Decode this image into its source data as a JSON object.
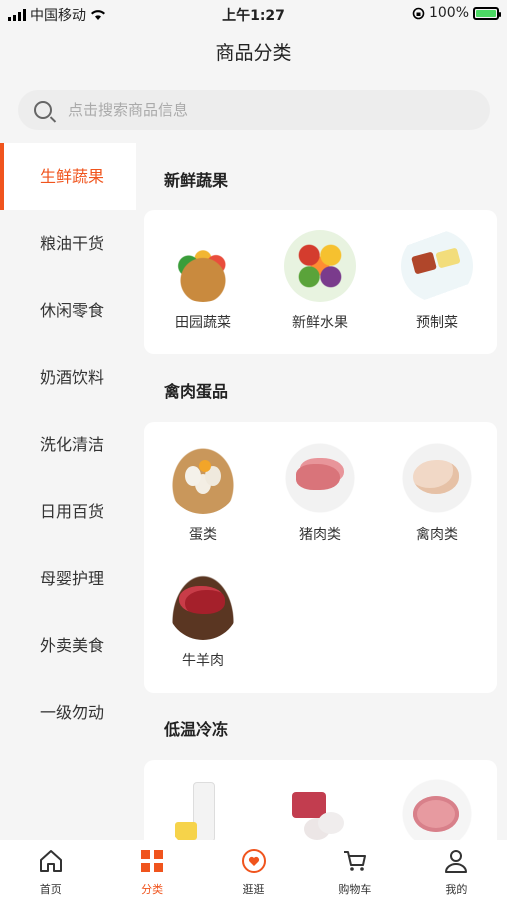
{
  "status_bar": {
    "carrier": "中国移动",
    "time": "上午1:27",
    "battery": "100%"
  },
  "header": {
    "title": "商品分类"
  },
  "search": {
    "placeholder": "点击搜索商品信息"
  },
  "sidebar": {
    "items": [
      {
        "label": "生鲜蔬果",
        "active": true
      },
      {
        "label": "粮油干货"
      },
      {
        "label": "休闲零食"
      },
      {
        "label": "奶酒饮料"
      },
      {
        "label": "洗化清洁"
      },
      {
        "label": "日用百货"
      },
      {
        "label": "母婴护理"
      },
      {
        "label": "外卖美食"
      },
      {
        "label": "一级勿动"
      }
    ]
  },
  "sections": [
    {
      "title": "新鲜蔬果",
      "items": [
        {
          "label": "田园蔬菜",
          "icon": "vegetable-basket-image"
        },
        {
          "label": "新鲜水果",
          "icon": "fruit-platter-image"
        },
        {
          "label": "预制菜",
          "icon": "prepared-dish-image"
        }
      ]
    },
    {
      "title": "禽肉蛋品",
      "items": [
        {
          "label": "蛋类",
          "icon": "eggs-image"
        },
        {
          "label": "猪肉类",
          "icon": "pork-image"
        },
        {
          "label": "禽肉类",
          "icon": "poultry-image"
        },
        {
          "label": "牛羊肉",
          "icon": "beef-image"
        }
      ]
    },
    {
      "title": "低温冷冻",
      "items": [
        {
          "icon": "yogurt-image"
        },
        {
          "icon": "frozen-dumpling-image"
        },
        {
          "icon": "ham-image"
        }
      ]
    }
  ],
  "tabbar": {
    "items": [
      {
        "label": "首页",
        "icon": "home-icon"
      },
      {
        "label": "分类",
        "icon": "category-icon",
        "active": true
      },
      {
        "label": "逛逛",
        "icon": "heart-badge-icon"
      },
      {
        "label": "购物车",
        "icon": "cart-icon"
      },
      {
        "label": "我的",
        "icon": "user-icon"
      }
    ]
  },
  "colors": {
    "accent": "#f0541d",
    "background": "#f5f5f5",
    "card": "#ffffff"
  }
}
